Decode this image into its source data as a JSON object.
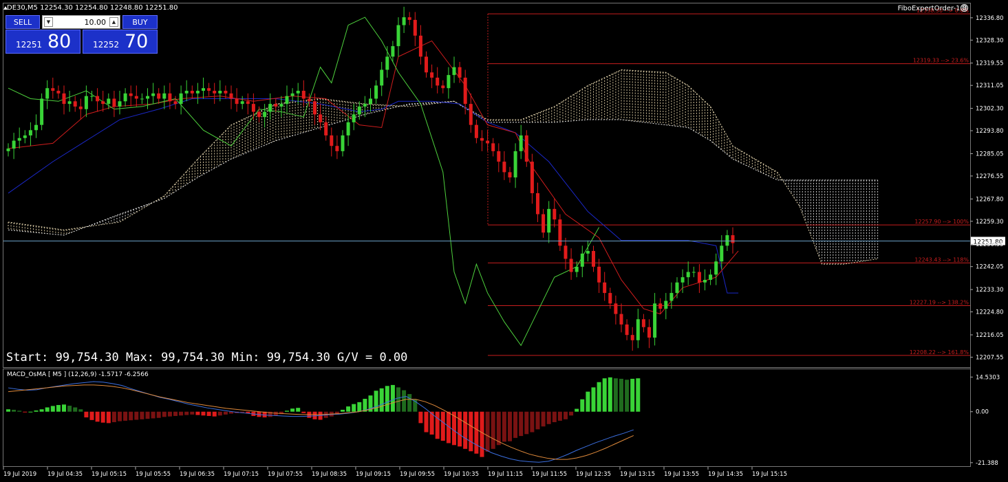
{
  "window": {
    "symbol_title": "DE30,M5 12254.30 12254.80 12248.80 12251.80",
    "expert_name": "FiboExpertOrder-1.8"
  },
  "trade_panel": {
    "sell_label": "SELL",
    "buy_label": "BUY",
    "lot_value": "10.00",
    "bid_small": "12251",
    "bid_big": "80",
    "ask_small": "12252",
    "ask_big": "70"
  },
  "stats_text": "Start: 99,754.30 Max: 99,754.30 Min: 99,754.30 G/V = 0.00",
  "indicator_title": "MACD_OsMA [ M5 ] (12,26,9) -1.5717 -6.2566",
  "colors": {
    "bull": "#39d437",
    "bear": "#e01b1b",
    "fib": "#c81e1e",
    "tenkan": "#d01d1d",
    "kijun": "#1b28c8",
    "chikou": "#4ed13d",
    "price_line": "#6aa0c8",
    "osma_bull": "#39d437",
    "osma_bear": "#e01b1b"
  },
  "chart_data": [
    {
      "type": "candlestick",
      "price_axis": {
        "min": 12204.0,
        "max": 12342.0,
        "ticks": [
          "12336.80",
          "12328.30",
          "12319.55",
          "12311.05",
          "12302.30",
          "12293.80",
          "12285.05",
          "12276.55",
          "12267.80",
          "12259.30",
          "12250.55",
          "12242.05",
          "12233.30",
          "12224.80",
          "12216.05",
          "12207.55"
        ]
      },
      "current_price": "12251.80",
      "time_labels": [
        "19 Jul 2019",
        "19 Jul 04:35",
        "19 Jul 05:15",
        "19 Jul 05:55",
        "19 Jul 06:35",
        "19 Jul 07:15",
        "19 Jul 07:55",
        "19 Jul 08:35",
        "19 Jul 09:15",
        "19 Jul 09:55",
        "19 Jul 10:35",
        "19 Jul 11:15",
        "19 Jul 11:55",
        "19 Jul 12:35",
        "19 Jul 13:15",
        "19 Jul 13:55",
        "19 Jul 14:35",
        "19 Jul 15:15"
      ],
      "closes": [
        12287,
        12290,
        12291,
        12292,
        12294,
        12296,
        12306,
        12310,
        12309,
        12308,
        12304,
        12305,
        12303,
        12302,
        12307,
        12307,
        12305,
        12304,
        12306,
        12303,
        12305,
        12308,
        12307,
        12306,
        12306,
        12307,
        12308,
        12306,
        12308,
        12305,
        12304,
        12308,
        12309,
        12308,
        12309,
        12310,
        12309,
        12308,
        12309,
        12308,
        12306,
        12304,
        12305,
        12304,
        12301,
        12299,
        12301,
        12304,
        12303,
        12304,
        12307,
        12308,
        12309,
        12306,
        12305,
        12300,
        12297,
        12292,
        12288,
        12286,
        12292,
        12297,
        12300,
        12303,
        12304,
        12306,
        12311,
        12317,
        12322,
        12326,
        12334,
        12337,
        12336,
        12330,
        12322,
        12316,
        12314,
        12311,
        12310,
        12315,
        12318,
        12314,
        12304,
        12296,
        12291,
        12290,
        12289,
        12286,
        12282,
        12278,
        12276,
        12286,
        12292,
        12282,
        12270,
        12262,
        12255,
        12264,
        12260,
        12250,
        12245,
        12240,
        12242,
        12247,
        12248,
        12242,
        12236,
        12232,
        12228,
        12224,
        12220,
        12216,
        12214,
        12222,
        12219,
        12215,
        12228,
        12226,
        12229,
        12232,
        12236,
        12238,
        12240,
        12240,
        12236,
        12237,
        12239,
        12244,
        12250,
        12254,
        12251
      ],
      "ichimoku": {
        "tenkan": [
          [
            0,
            12287
          ],
          [
            8,
            12289
          ],
          [
            14,
            12300
          ],
          [
            19,
            12303
          ],
          [
            26,
            12304
          ],
          [
            31,
            12306
          ],
          [
            38,
            12307
          ],
          [
            44,
            12305
          ],
          [
            51,
            12307
          ],
          [
            57,
            12306
          ],
          [
            63,
            12296
          ],
          [
            67,
            12295
          ],
          [
            70,
            12322
          ],
          [
            76,
            12328
          ],
          [
            82,
            12311
          ],
          [
            86,
            12296
          ],
          [
            91,
            12293
          ],
          [
            94,
            12280
          ],
          [
            100,
            12262
          ],
          [
            106,
            12253
          ],
          [
            110,
            12237
          ],
          [
            114,
            12226
          ],
          [
            117,
            12224
          ],
          [
            121,
            12234
          ],
          [
            127,
            12238
          ],
          [
            131,
            12248
          ]
        ],
        "kijun": [
          [
            0,
            12270
          ],
          [
            8,
            12282
          ],
          [
            14,
            12290
          ],
          [
            20,
            12298
          ],
          [
            27,
            12302
          ],
          [
            33,
            12306
          ],
          [
            40,
            12306
          ],
          [
            48,
            12306
          ],
          [
            56,
            12304
          ],
          [
            63,
            12301
          ],
          [
            67,
            12302
          ],
          [
            70,
            12305
          ],
          [
            76,
            12305
          ],
          [
            81,
            12304
          ],
          [
            86,
            12297
          ],
          [
            91,
            12293
          ],
          [
            97,
            12282
          ],
          [
            104,
            12263
          ],
          [
            110,
            12252
          ],
          [
            116,
            12252
          ],
          [
            122,
            12252
          ],
          [
            127,
            12250
          ],
          [
            129,
            12232
          ],
          [
            131,
            12232
          ]
        ],
        "chikou": [
          [
            0,
            12310
          ],
          [
            4,
            12306
          ],
          [
            9,
            12305
          ],
          [
            14,
            12309
          ],
          [
            19,
            12302
          ],
          [
            24,
            12303
          ],
          [
            30,
            12306
          ],
          [
            35,
            12294
          ],
          [
            40,
            12288
          ],
          [
            45,
            12302
          ],
          [
            49,
            12301
          ],
          [
            53,
            12299
          ],
          [
            56,
            12318
          ],
          [
            58,
            12312
          ],
          [
            61,
            12334
          ],
          [
            64,
            12337
          ],
          [
            67,
            12328
          ],
          [
            70,
            12316
          ],
          [
            74,
            12304
          ],
          [
            78,
            12278
          ],
          [
            80,
            12240
          ],
          [
            82,
            12228
          ],
          [
            84,
            12243
          ],
          [
            86,
            12232
          ],
          [
            89,
            12221
          ],
          [
            92,
            12212
          ],
          [
            95,
            12225
          ],
          [
            98,
            12238
          ],
          [
            102,
            12242
          ],
          [
            106,
            12257
          ]
        ],
        "span_a": [
          [
            0,
            12259
          ],
          [
            10,
            12256
          ],
          [
            20,
            12259
          ],
          [
            28,
            12269
          ],
          [
            34,
            12283
          ],
          [
            40,
            12296
          ],
          [
            48,
            12304
          ],
          [
            56,
            12306
          ],
          [
            64,
            12304
          ],
          [
            72,
            12303
          ],
          [
            80,
            12305
          ],
          [
            86,
            12298
          ],
          [
            92,
            12298
          ],
          [
            98,
            12303
          ],
          [
            104,
            12311
          ],
          [
            110,
            12317
          ],
          [
            118,
            12316
          ],
          [
            122,
            12311
          ],
          [
            126,
            12303
          ],
          [
            130,
            12288
          ],
          [
            138,
            12278
          ],
          [
            142,
            12265
          ],
          [
            146,
            12243
          ],
          [
            150,
            12243
          ],
          [
            156,
            12245
          ]
        ],
        "span_b": [
          [
            0,
            12256
          ],
          [
            10,
            12254
          ],
          [
            20,
            12262
          ],
          [
            28,
            12268
          ],
          [
            34,
            12276
          ],
          [
            40,
            12283
          ],
          [
            48,
            12290
          ],
          [
            56,
            12295
          ],
          [
            64,
            12300
          ],
          [
            72,
            12304
          ],
          [
            80,
            12305
          ],
          [
            86,
            12297
          ],
          [
            92,
            12297
          ],
          [
            98,
            12297
          ],
          [
            104,
            12298
          ],
          [
            110,
            12298
          ],
          [
            118,
            12296
          ],
          [
            122,
            12295
          ],
          [
            126,
            12290
          ],
          [
            130,
            12283
          ],
          [
            138,
            12275
          ],
          [
            142,
            12275
          ],
          [
            146,
            12275
          ],
          [
            150,
            12275
          ],
          [
            156,
            12275
          ]
        ]
      },
      "fibonacci_levels": [
        {
          "label": "12338.30 --> 0.0%",
          "price": 12338.3
        },
        {
          "label": "12319.33 --> 23.6%",
          "price": 12319.33
        },
        {
          "label": "12257.90 --> 100%",
          "price": 12257.9
        },
        {
          "label": "12243.43 --> 118%",
          "price": 12243.43
        },
        {
          "label": "12227.19 --> 138.2%",
          "price": 12227.19
        },
        {
          "label": "12208.22 --> 161.8%",
          "price": 12208.22
        }
      ]
    },
    {
      "type": "bar",
      "name": "MACD_OsMA",
      "axis_ticks": [
        "14.5303",
        "0.00",
        "-21.388"
      ],
      "ylim": [
        -22,
        15.5
      ],
      "osma": [
        1,
        0.8,
        0.4,
        -0.2,
        0,
        0.5,
        1,
        1.8,
        2.4,
        2.8,
        3,
        2.5,
        1.8,
        1,
        -2.4,
        -3.5,
        -4.2,
        -4.6,
        -4.8,
        -4.4,
        -4,
        -3.8,
        -3.6,
        -3.4,
        -3.2,
        -3,
        -2.8,
        -2.6,
        -2.2,
        -2,
        -1.8,
        -1.6,
        -1.4,
        -1.2,
        -1.4,
        -1.6,
        -1.8,
        -2,
        -1.6,
        -1.2,
        -0.8,
        -0.6,
        -0.4,
        -0.8,
        -1.8,
        -2.2,
        -2.4,
        -2.2,
        -1.6,
        -1,
        0.4,
        1.3,
        1.6,
        -0.6,
        -2.6,
        -3.2,
        -3.4,
        -2.6,
        -2,
        -1.2,
        0.8,
        2.2,
        3.2,
        4,
        5.4,
        6.8,
        8.8,
        9.8,
        10.8,
        11.2,
        10.2,
        9,
        7.4,
        5.2,
        -4.8,
        -8.6,
        -9.6,
        -11.4,
        -12.2,
        -13.2,
        -14,
        -14.6,
        -15.6,
        -16.6,
        -17.6,
        -19,
        -16.8,
        -15.6,
        -14,
        -12.6,
        -12.4,
        -11,
        -10.2,
        -9.4,
        -8.6,
        -7.4,
        -6.2,
        -5.2,
        -4.4,
        -3.8,
        -3.2,
        -1.6,
        1.2,
        5.2,
        8.4,
        10.2,
        12.4,
        14,
        14.4,
        14,
        13.8,
        13.4,
        13.8,
        14
      ],
      "macd_line": [
        10,
        9.4,
        9,
        9.2,
        10,
        10.6,
        11.2,
        11.8,
        12.2,
        12.6,
        12.4,
        11.8,
        11,
        9.6,
        8.4,
        7.2,
        6,
        5.2,
        4.2,
        3.2,
        2.4,
        1.6,
        1,
        0.4,
        -0.2,
        -0.6,
        -1,
        -1.4,
        -1.6,
        -1.8,
        -2,
        -2,
        -1.8,
        -1.6,
        -1.2,
        -1,
        -0.6,
        0,
        1,
        2.4,
        4,
        5.6,
        6.4,
        4.2,
        1.4,
        -1.8,
        -4.8,
        -7.8,
        -10.6,
        -13,
        -15.2,
        -17.2,
        -18.6,
        -19.8,
        -20.6,
        -21,
        -21.2,
        -20.8,
        -19.6,
        -18,
        -16.2,
        -14.6,
        -13,
        -11.6,
        -10.2,
        -9,
        -7.6
      ],
      "signal_line": [
        8.4,
        8.8,
        9.2,
        9.6,
        10,
        10.4,
        10.8,
        11,
        11.2,
        11.2,
        11,
        10.6,
        10,
        9.2,
        8.2,
        7.2,
        6.2,
        5.4,
        4.6,
        3.8,
        3.2,
        2.6,
        2,
        1.4,
        1,
        0.6,
        0.2,
        -0.2,
        -0.6,
        -0.8,
        -1,
        -1.2,
        -1.2,
        -1.2,
        -1,
        -0.8,
        -0.4,
        0,
        0.8,
        1.8,
        3,
        4.2,
        5.2,
        5.2,
        4.2,
        2.6,
        0.6,
        -1.6,
        -4,
        -6.4,
        -8.8,
        -11,
        -13,
        -14.8,
        -16.4,
        -17.8,
        -18.8,
        -19.6,
        -20,
        -20,
        -19.4,
        -18.4,
        -17,
        -15.4,
        -13.6,
        -11.8,
        -10
      ]
    }
  ]
}
